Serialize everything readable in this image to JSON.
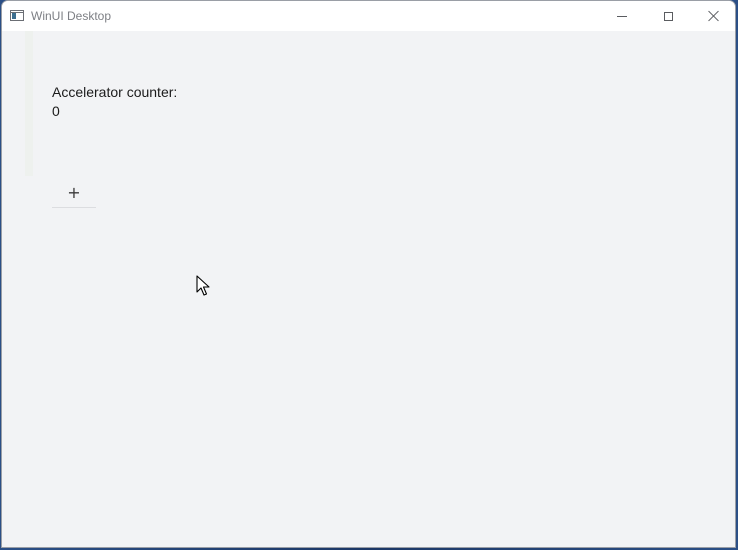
{
  "window": {
    "title": "WinUI Desktop",
    "icon": "app-window-icon",
    "caption_buttons": [
      "minimize-icon",
      "maximize-icon",
      "close-icon"
    ]
  },
  "main": {
    "counter_label": "Accelerator counter:",
    "counter_value": "0",
    "add_button_label": "+"
  },
  "cursor": {
    "icon": "mouse-pointer-icon"
  }
}
